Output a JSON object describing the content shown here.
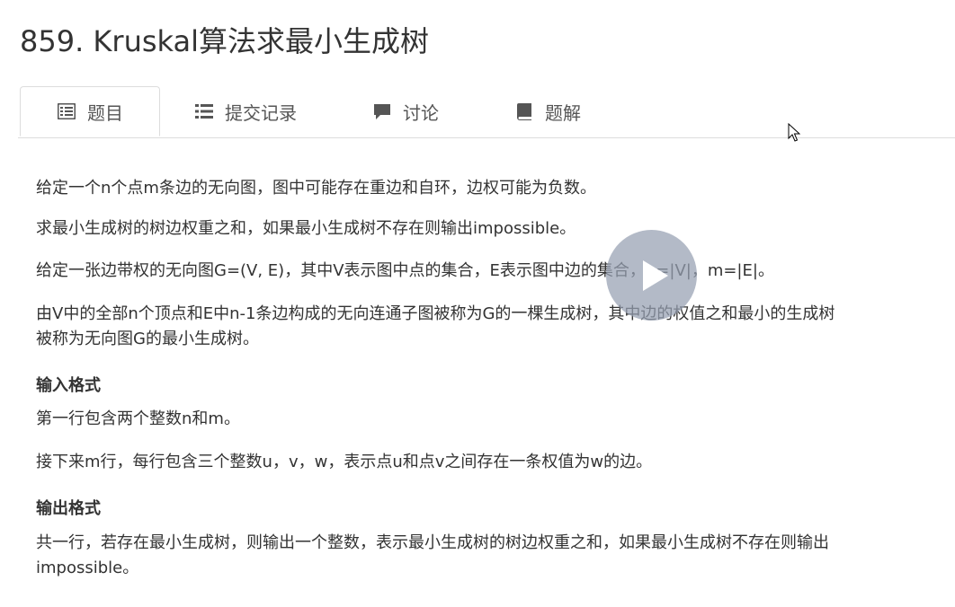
{
  "page": {
    "title": "859. Kruskal算法求最小生成树"
  },
  "tabs": [
    {
      "label": "题目",
      "icon": "list-alt-icon",
      "active": true
    },
    {
      "label": "提交记录",
      "icon": "list-icon",
      "active": false
    },
    {
      "label": "讨论",
      "icon": "comment-icon",
      "active": false
    },
    {
      "label": "题解",
      "icon": "book-icon",
      "active": false
    }
  ],
  "problem": {
    "p1": "给定一个n个点m条边的无向图，图中可能存在重边和自环，边权可能为负数。",
    "p2": "求最小生成树的树边权重之和，如果最小生成树不存在则输出impossible。",
    "p3": "给定一张边带权的无向图G=(V, E)，其中V表示图中点的集合，E表示图中边的集合，n=|V|，m=|E|。",
    "p4_line1": "由V中的全部n个顶点和E中n-1条边构成的无向连通子图被称为G的一棵生成树，其中边的权值之和最小的生成树",
    "p4_line2": "被称为无向图G的最小生成树。",
    "input_heading": "输入格式",
    "input_p1": "第一行包含两个整数n和m。",
    "input_p2": "接下来m行，每行包含三个整数u，v，w，表示点u和点v之间存在一条权值为w的边。",
    "output_heading": "输出格式",
    "output_line1": "共一行，若存在最小生成树，则输出一个整数，表示最小生成树的树边权重之和，如果最小生成树不存在则输出",
    "output_line2": "impossible。"
  },
  "video_overlay": {
    "icon": "play-icon"
  },
  "colors": {
    "text": "#333333",
    "tab_text": "#555555",
    "border": "#dddddd",
    "play_bg": "#96a0b2"
  }
}
